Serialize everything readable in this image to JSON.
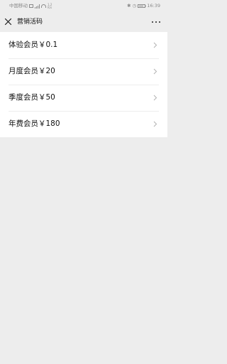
{
  "status_bar": {
    "carrier": "中国移动",
    "net_speed_value": "1.2",
    "net_speed_unit": "K/s",
    "time": "16:39"
  },
  "nav": {
    "title": "营销活码",
    "close_icon": "close-icon",
    "more_icon": "more-icon"
  },
  "items": [
    {
      "label": "体验会员￥0.1"
    },
    {
      "label": "月度会员￥20"
    },
    {
      "label": "季度会员￥50"
    },
    {
      "label": "年费会员￥180"
    }
  ],
  "colors": {
    "background": "#ededed",
    "list_background": "#ffffff",
    "text": "#111111",
    "chevron": "#b2b2b2"
  }
}
